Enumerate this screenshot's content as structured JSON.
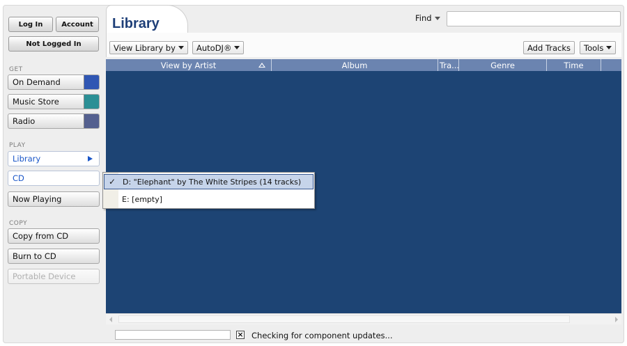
{
  "auth": {
    "login_label": "Log In",
    "account_label": "Account",
    "status": "Not Logged In"
  },
  "sidebar": {
    "get_header": "GET",
    "play_header": "PLAY",
    "copy_header": "COPY",
    "get_items": [
      {
        "label": "On Demand",
        "color": "#2f56b3"
      },
      {
        "label": "Music Store",
        "color": "#2b8f95"
      },
      {
        "label": "Radio",
        "color": "#54608f"
      }
    ],
    "play_items": [
      {
        "label": "Library"
      },
      {
        "label": "CD"
      },
      {
        "label": "Now Playing"
      }
    ],
    "copy_items": [
      {
        "label": "Copy from CD"
      },
      {
        "label": "Burn to CD"
      },
      {
        "label": "Portable Device"
      }
    ]
  },
  "header": {
    "title": "Library",
    "find_label": "Find",
    "find_value": ""
  },
  "toolbar": {
    "view_library": "View Library by",
    "autodj": "AutoDJ®",
    "add_tracks": "Add Tracks",
    "tools": "Tools"
  },
  "table": {
    "columns": [
      "View by Artist",
      "Album",
      "Tra...",
      "Genre",
      "Time"
    ],
    "sort_column": "View by Artist",
    "rows": []
  },
  "cd_menu": {
    "items": [
      {
        "label": "D: \"Elephant\" by The White Stripes (14 tracks)",
        "checked": true
      },
      {
        "label": "E: [empty]",
        "checked": false
      }
    ]
  },
  "status": {
    "text": "Checking for component updates...",
    "cancel_glyph": "×"
  },
  "colors": {
    "accent": "#1a56c8",
    "title": "#1e3f78",
    "grid_header": "#6b84b0",
    "grid_body": "#1d4474"
  }
}
